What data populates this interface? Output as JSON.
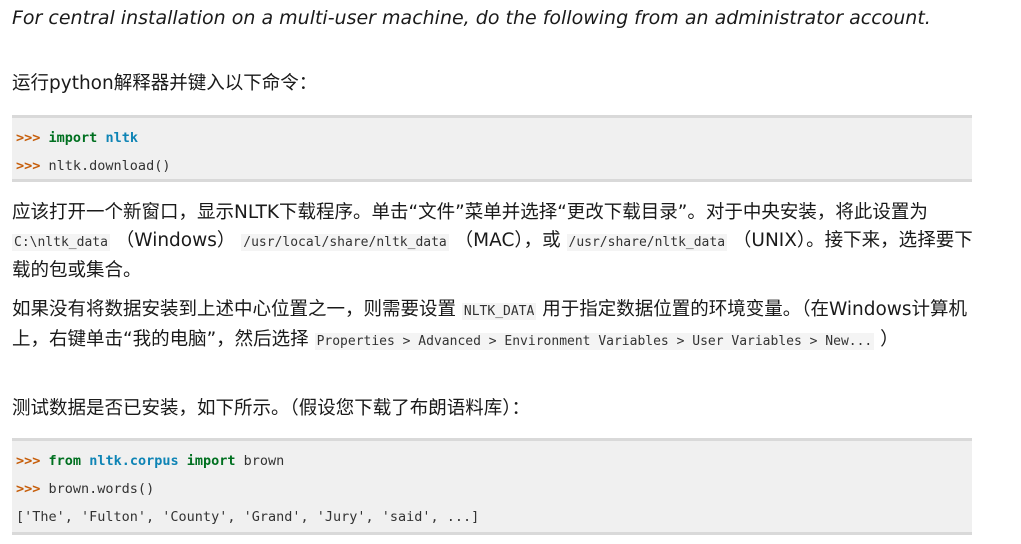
{
  "intro": "For central installation on a multi-user machine, do the following from an administrator account.",
  "run_python": "运行python解释器并键入以下命令：",
  "code_block_1": {
    "prompt": ">>>",
    "line1_kw": "import",
    "line1_mod": "nltk",
    "line2": "nltk.download()"
  },
  "para_window": {
    "t1": "应该打开一个新窗口，显示NLTK下载程序。单击“文件”菜单并选择“更改下载目录”。对于中央安装，将此设置为 ",
    "path_windows": "C:\\nltk_data",
    "t2": " （Windows） ",
    "path_mac": "/usr/local/share/nltk_data",
    "t3": " （MAC），或 ",
    "path_unix": "/usr/share/nltk_data",
    "t4": " （UNIX）。接下来，选择要下载的包或集合。"
  },
  "para_env": {
    "t1": "如果没有将数据安装到上述中心位置之一，则需要设置 ",
    "var": "NLTK_DATA",
    "t2": " 用于指定数据位置的环境变量。（在Windows计算机上，右键单击“我的电脑”，然后选择 ",
    "menu_path": "Properties > Advanced > Environment Variables > User Variables > New...",
    "t3": " ）"
  },
  "test_line": "测试数据是否已安装，如下所示。（假设您下载了布朗语料库）：",
  "code_block_2": {
    "prompt": ">>>",
    "line1_from": "from",
    "line1_mod": "nltk.corpus",
    "line1_import": "import",
    "line1_name": "brown",
    "line2": "brown.words()",
    "output": "['The', 'Fulton', 'County', 'Grand', 'Jury', 'said', ...]"
  }
}
